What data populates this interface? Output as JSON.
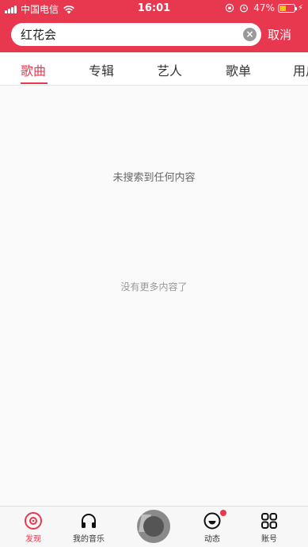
{
  "status_bar": {
    "carrier": "中国电信",
    "time": "16:01",
    "battery_percent": "47%",
    "battery_level": 0.47
  },
  "search": {
    "query": "红花会",
    "cancel_label": "取消",
    "clear_icon": "clear-icon"
  },
  "tabs": [
    {
      "label": "歌曲",
      "active": true
    },
    {
      "label": "专辑",
      "active": false
    },
    {
      "label": "艺人",
      "active": false
    },
    {
      "label": "歌单",
      "active": false
    },
    {
      "label": "用户",
      "active": false
    }
  ],
  "content": {
    "empty_message": "未搜索到任何内容",
    "no_more_message": "没有更多内容了"
  },
  "bottom_nav": [
    {
      "label": "发现",
      "icon": "discover-icon",
      "active": true
    },
    {
      "label": "我的音乐",
      "icon": "headphones-icon",
      "active": false
    },
    {
      "label": "",
      "icon": "now-playing-album",
      "active": false
    },
    {
      "label": "动态",
      "icon": "activity-icon",
      "active": false,
      "badge": true
    },
    {
      "label": "账号",
      "icon": "account-grid-icon",
      "active": false
    }
  ],
  "colors": {
    "accent": "#e8384f",
    "background": "#fafafa"
  }
}
